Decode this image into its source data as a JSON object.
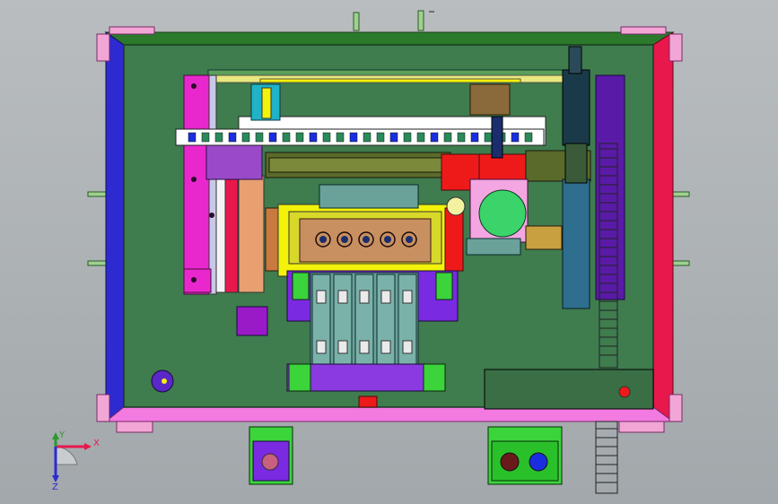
{
  "viewport": {
    "background": "#a9afb2",
    "triad": {
      "x_label": "X",
      "y_label": "Y",
      "z_label": "Z"
    }
  },
  "colors": {
    "frame_blue": "#2d2ad2",
    "frame_red": "#e8184c",
    "frame_green": "#2b7a2b",
    "frame_pink": "#f27ae0",
    "base_plate": "#3f7c4e",
    "magenta": "#e828cc",
    "purple": "#7a19c9",
    "yellow": "#f2f20a",
    "cyan": "#1fb2c8",
    "red": "#ee1a1a",
    "teal": "#6aa29a",
    "orange_brown": "#c87a40",
    "dark_olive": "#5a6a2a",
    "bright_green": "#3bd43b",
    "navy": "#1a2e6e"
  },
  "icons": [
    "xyz-triad-icon",
    "y-axis-arrow-icon",
    "x-axis-arrow-icon",
    "z-axis-arrow-icon"
  ]
}
